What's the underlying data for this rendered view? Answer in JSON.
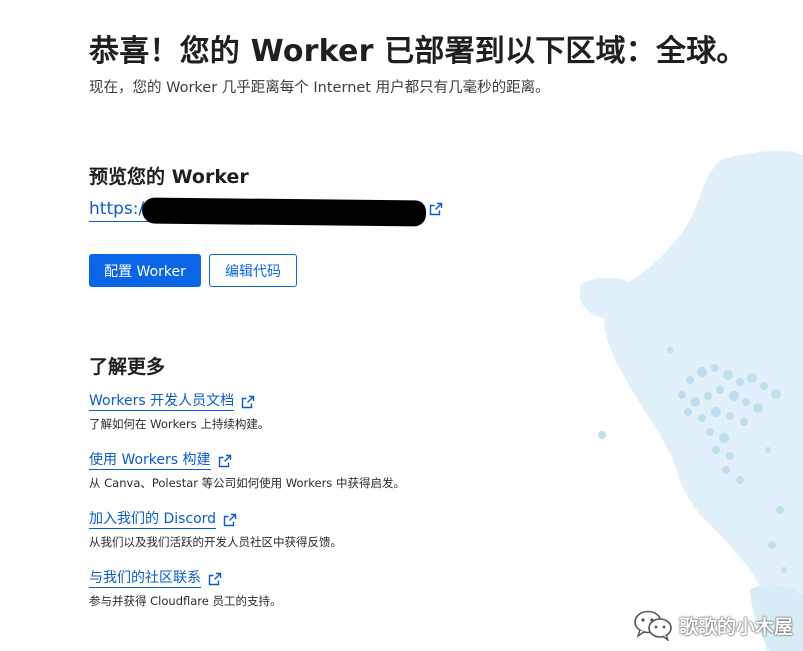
{
  "header": {
    "title": "恭喜！您的 Worker 已部署到以下区域：全球。",
    "subtitle": "现在，您的 Worker 几乎距离每个 Internet 用户都只有几毫秒的距离。"
  },
  "preview": {
    "heading": "预览您的 Worker",
    "url_prefix": "https://",
    "url_icon": "external-link-icon"
  },
  "actions": {
    "configure_label": "配置 Worker",
    "edit_code_label": "编辑代码"
  },
  "learn_more": {
    "heading": "了解更多",
    "items": [
      {
        "link": "Workers 开发人员文档",
        "desc": "了解如何在 Workers 上持续构建。"
      },
      {
        "link": "使用 Workers 构建",
        "desc": "从 Canva、Polestar 等公司如何使用 Workers 中获得启发。"
      },
      {
        "link": "加入我们的 Discord",
        "desc": "从我们以及我们活跃的开发人员社区中获得反馈。"
      },
      {
        "link": "与我们的社区联系",
        "desc": "参与并获得 Cloudflare 员工的支持。"
      }
    ]
  },
  "watermark": {
    "text": "歌歌的小木屋",
    "icon": "wechat-icon"
  },
  "colors": {
    "accent": "#0a66e6",
    "link": "#0b5cc9",
    "map_land": "#e2f1f9",
    "map_dot": "#bfdeee"
  }
}
